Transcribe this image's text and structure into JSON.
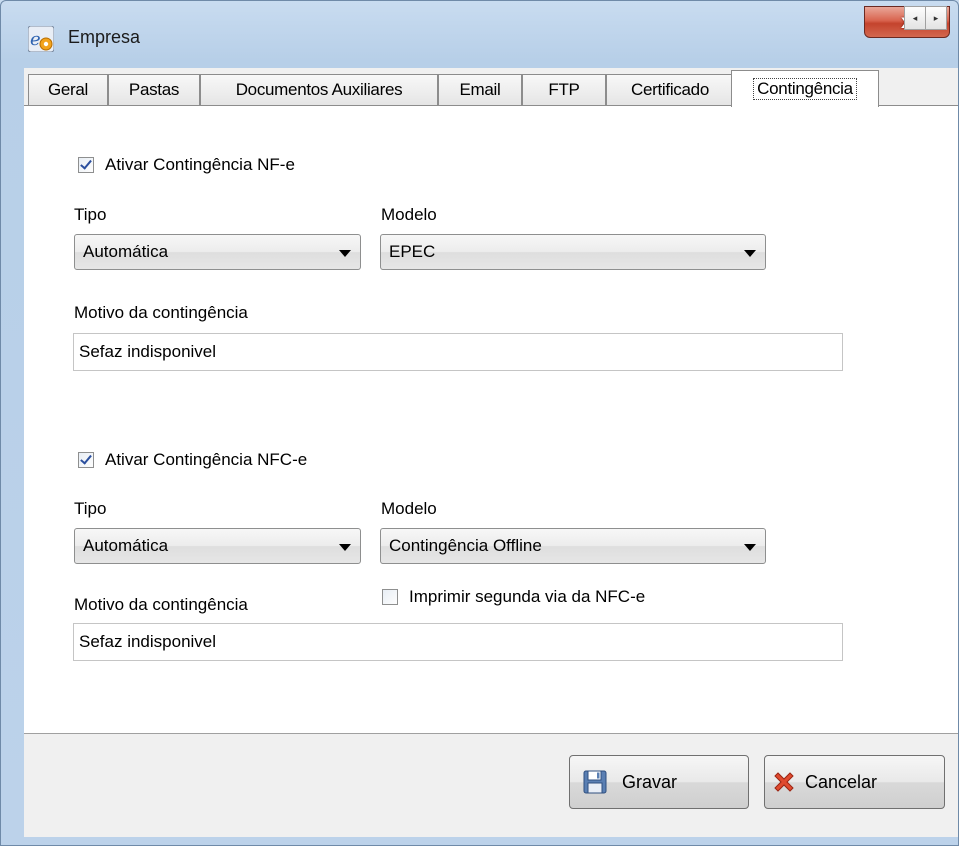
{
  "window": {
    "title": "Empresa",
    "close_label": "x"
  },
  "tabs": [
    {
      "label": "Geral"
    },
    {
      "label": "Pastas"
    },
    {
      "label": "Documentos Auxiliares"
    },
    {
      "label": "Email"
    },
    {
      "label": "FTP"
    },
    {
      "label": "Certificado"
    },
    {
      "label": "Contingência",
      "active": true
    }
  ],
  "tab_scroll": {
    "left_icon": "◂",
    "right_icon": "▸"
  },
  "nfe": {
    "enable_label": "Ativar Contingência NF-e",
    "enabled": true,
    "tipo_label": "Tipo",
    "tipo_value": "Automática",
    "modelo_label": "Modelo",
    "modelo_value": "EPEC",
    "motivo_label": "Motivo da contingência",
    "motivo_value": "Sefaz indisponivel"
  },
  "nfce": {
    "enable_label": "Ativar Contingência NFC-e",
    "enabled": true,
    "tipo_label": "Tipo",
    "tipo_value": "Automática",
    "modelo_label": "Modelo",
    "modelo_value": "Contingência Offline",
    "motivo_label": "Motivo da contingência",
    "motivo_value": "Sefaz indisponivel",
    "print_second_copy_label": "Imprimir segunda via da NFC-e",
    "print_second_copy": false
  },
  "buttons": {
    "save_label": "Gravar",
    "cancel_label": "Cancelar"
  },
  "icons": {
    "app": "app-logo-icon",
    "save": "floppy-disk-icon",
    "cancel": "red-x-icon"
  },
  "colors": {
    "checkmark": "#2b4f9e",
    "close_button": "#c4432d"
  }
}
